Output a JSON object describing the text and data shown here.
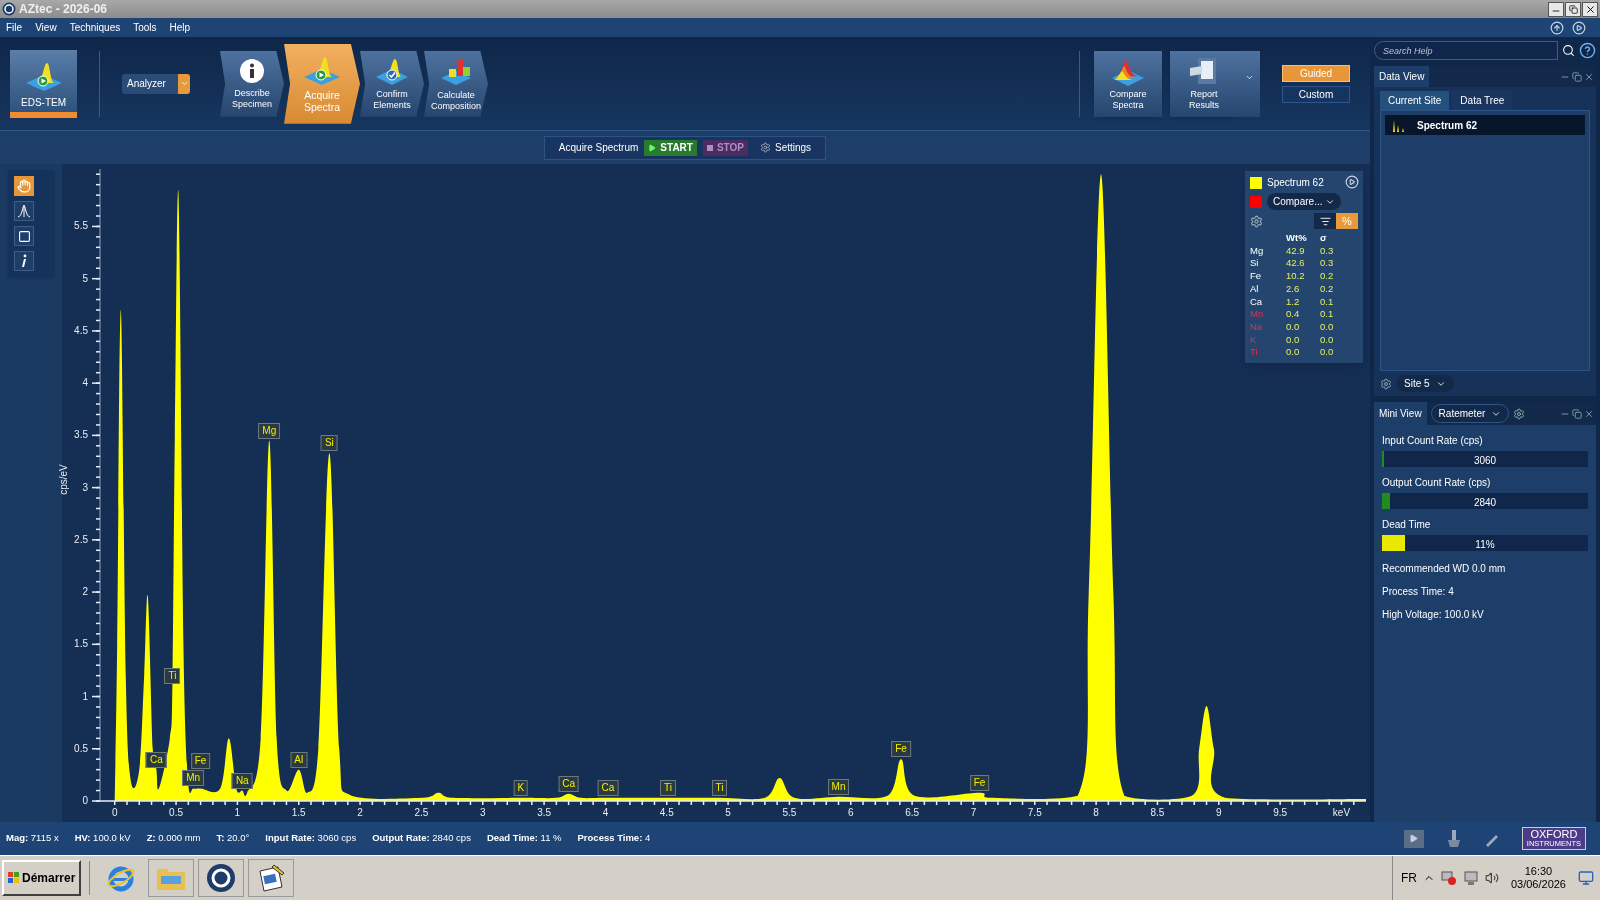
{
  "window": {
    "title": "AZtec - 2026-06"
  },
  "menu": [
    "File",
    "View",
    "Techniques",
    "Tools",
    "Help"
  ],
  "toolbar": {
    "application": "EDS-TEM",
    "analyzer": "Analyzer",
    "steps": [
      {
        "label": "Describe Specimen",
        "kind": "info",
        "selected": false
      },
      {
        "label": "Acquire Spectra",
        "kind": "acquire",
        "selected": true
      },
      {
        "label": "Confirm Elements",
        "kind": "confirm",
        "selected": false
      },
      {
        "label": "Calculate Composition",
        "kind": "calculate",
        "selected": false
      }
    ],
    "actions": [
      {
        "label": "Compare Spectra",
        "kind": "compare"
      },
      {
        "label": "Report Results",
        "kind": "report"
      }
    ],
    "modes": [
      {
        "label": "Guided",
        "selected": true
      },
      {
        "label": "Custom",
        "selected": false
      }
    ]
  },
  "acquire_bar": {
    "label": "Acquire Spectrum",
    "start": "START",
    "stop": "STOP",
    "settings": "Settings"
  },
  "tools": [
    {
      "kind": "hand",
      "selected": true
    },
    {
      "kind": "peak",
      "selected": false
    },
    {
      "kind": "rectangle",
      "selected": false
    },
    {
      "kind": "info",
      "selected": false
    }
  ],
  "results": {
    "compare": {
      "label": "Compare...",
      "color": "#ff0000"
    },
    "toggles": [
      {
        "kind": "icon",
        "selected": false
      },
      {
        "kind": "text",
        "label": "%",
        "selected": true
      }
    ],
    "columns": [
      "Wt%",
      "σ"
    ],
    "rows": [
      {
        "element": "Mg",
        "wt": "42.9",
        "sigma": "0.3",
        "flagged": false
      },
      {
        "element": "Si",
        "wt": "42.6",
        "sigma": "0.3",
        "flagged": false
      },
      {
        "element": "Fe",
        "wt": "10.2",
        "sigma": "0.2",
        "flagged": false
      },
      {
        "element": "Al",
        "wt": "2.6",
        "sigma": "0.2",
        "flagged": false
      },
      {
        "element": "Ca",
        "wt": "1.2",
        "sigma": "0.1",
        "flagged": false
      },
      {
        "element": "Mn",
        "wt": "0.4",
        "sigma": "0.1",
        "flagged": true
      },
      {
        "element": "Na",
        "wt": "0.0",
        "sigma": "0.0",
        "flagged": true
      },
      {
        "element": "K",
        "wt": "0.0",
        "sigma": "0.0",
        "flagged": true
      },
      {
        "element": "Ti",
        "wt": "0.0",
        "sigma": "0.0",
        "flagged": true
      }
    ]
  },
  "chart_data": {
    "type": "area",
    "ylabel": "cps/eV",
    "x": [
      0,
      0.02,
      0.05,
      0.09,
      0.13,
      0.2,
      0.24,
      0.27,
      0.31,
      0.34,
      0.36,
      0.45,
      0.47,
      0.49,
      0.52,
      0.56,
      0.6,
      0.64,
      0.7,
      0.86,
      0.93,
      0.99,
      1.04,
      1.08,
      1.19,
      1.26,
      1.32,
      1.4,
      1.5,
      1.57,
      1.66,
      1.75,
      1.83,
      1.93,
      2.5,
      2.64,
      2.76,
      3.31,
      3.6,
      3.7,
      3.8,
      4.02,
      4.51,
      4.93,
      5.3,
      5.42,
      5.54,
      5.9,
      6.3,
      6.41,
      6.52,
      7.05,
      7.15,
      7.85,
      7.94,
      8.04,
      8.14,
      8.23,
      8.78,
      8.84,
      8.9,
      8.96,
      9.05,
      10.2
    ],
    "series": [
      {
        "name": "Spectrum 62",
        "color": "#ffff00",
        "values": [
          0,
          1.5,
          4.7,
          1.2,
          0.2,
          0.3,
          1.2,
          1.96,
          0.5,
          0.3,
          0.12,
          0.6,
          1.1,
          3.5,
          5.81,
          1.5,
          0.15,
          0.12,
          0.12,
          0.12,
          0.6,
          0.12,
          0.1,
          0.08,
          0.6,
          3.45,
          0.6,
          0.1,
          0.3,
          0.08,
          0.5,
          3.33,
          0.5,
          0.05,
          0.03,
          0.08,
          0.03,
          0.03,
          0.03,
          0.07,
          0.03,
          0.03,
          0.03,
          0.03,
          0.03,
          0.22,
          0.03,
          0.04,
          0.05,
          0.4,
          0.05,
          0.08,
          0.03,
          0.05,
          2.0,
          6.0,
          2.0,
          0.05,
          0.05,
          0.5,
          0.91,
          0.5,
          0.03,
          0.02
        ]
      }
    ],
    "xlim": [
      -0.12,
      10.2
    ],
    "ylim": [
      0,
      6.05
    ],
    "xticks": [
      0,
      0.5,
      1,
      1.5,
      2,
      2.5,
      3,
      3.5,
      4,
      4.5,
      5,
      5.5,
      6,
      6.5,
      7,
      7.5,
      8,
      8.5,
      9,
      9.5,
      {
        "value": 10,
        "label": "keV"
      }
    ],
    "yticks": [
      0,
      0.5,
      1,
      1.5,
      2,
      2.5,
      3,
      3.5,
      4,
      4.5,
      5,
      5.5
    ],
    "annotations": [
      {
        "x": 0.47,
        "y": 1.1,
        "text": "Ti"
      },
      {
        "x": 0.34,
        "y": 0.3,
        "text": "Ca"
      },
      {
        "x": 0.64,
        "y": 0.12,
        "text": "Mn"
      },
      {
        "x": 0.7,
        "y": 0.12,
        "text": "Fe"
      },
      {
        "x": 1.04,
        "y": 0.1,
        "text": "Na"
      },
      {
        "x": 1.26,
        "y": 3.45,
        "text": "Mg"
      },
      {
        "x": 1.5,
        "y": 0.3,
        "text": "Al"
      },
      {
        "x": 1.75,
        "y": 3.33,
        "text": "Si"
      },
      {
        "x": 3.31,
        "y": 0.03,
        "text": "K"
      },
      {
        "x": 3.7,
        "y": 0.07,
        "text": "Ca"
      },
      {
        "x": 4.02,
        "y": 0.03,
        "text": "Ca"
      },
      {
        "x": 4.51,
        "y": 0.03,
        "text": "Ti"
      },
      {
        "x": 4.93,
        "y": 0.03,
        "text": "Ti"
      },
      {
        "x": 5.9,
        "y": 0.04,
        "text": "Mn"
      },
      {
        "x": 6.41,
        "y": 0.4,
        "text": "Fe"
      },
      {
        "x": 7.05,
        "y": 0.08,
        "text": "Fe"
      }
    ]
  },
  "search": {
    "placeholder": "Search Help"
  },
  "data_view": {
    "title": "Data View",
    "tabs": [
      {
        "label": "Current Site",
        "selected": true
      },
      {
        "label": "Data Tree",
        "selected": false
      }
    ],
    "items": [
      {
        "label": "Spectrum 62",
        "selected": true
      }
    ],
    "site": "Site 5"
  },
  "mini_view": {
    "title": "Mini View",
    "mode": "Ratemeter",
    "meters": [
      {
        "label": "Input Count Rate (cps)",
        "reading": "3060",
        "level": 0.01,
        "color": "#1e8c1e"
      },
      {
        "label": "Output Count Rate (cps)",
        "reading": "2840",
        "level": 0.04,
        "color": "#1e8c1e"
      },
      {
        "label": "Dead Time",
        "reading": "11%",
        "level": 0.11,
        "color": "#e8e800"
      }
    ],
    "info": [
      "Recommended WD 0.0 mm",
      "Process Time: 4",
      "High Voltage: 100.0 kV"
    ]
  },
  "status_bar": [
    "**Mag:** 7115 x",
    "**HV:** 100.0 kV",
    "**Z:** 0.000 mm",
    "**T:** 20.0°",
    "**Input Rate:** 3060 cps",
    "**Output Rate:** 2840 cps",
    "**Dead Time:** 11 %",
    "**Process Time:** 4"
  ],
  "logo": {
    "name": "OXFORD",
    "sub": "INSTRUMENTS"
  },
  "taskbar": {
    "start": "Démarrer",
    "language": "FR",
    "time": "16:30",
    "date": "03/06/2026"
  }
}
